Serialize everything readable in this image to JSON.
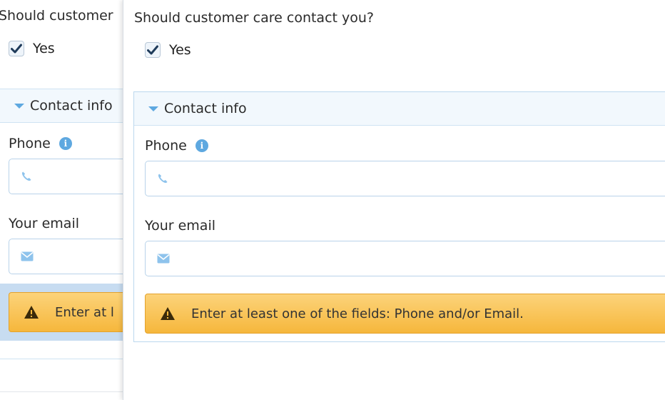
{
  "form": {
    "question": "Should customer care contact you?",
    "consent_label": "Yes",
    "consent_checked": true,
    "section_title": "Contact info",
    "phone_label": "Phone",
    "phone_value": "",
    "email_label": "Your email",
    "email_value": "",
    "warning_text": "Enter at least one of the fields: Phone and/or Email."
  },
  "background_clipped": {
    "question": "Should customer",
    "section_title": "Contact info",
    "warning_text": "Enter at l"
  },
  "icons": {
    "section_toggle": "triangle-down-icon",
    "phone_info": "info-icon",
    "phone_field": "phone-icon",
    "email_field": "envelope-icon",
    "warning": "warning-icon"
  },
  "colors": {
    "accent_blue": "#5ea8e0",
    "border_blue": "#bcd8ee",
    "header_bg": "#f2f8fd",
    "warning_bg": "#f6b73c",
    "warning_border": "#e3a22c",
    "checkmark": "#1f3b5a"
  }
}
